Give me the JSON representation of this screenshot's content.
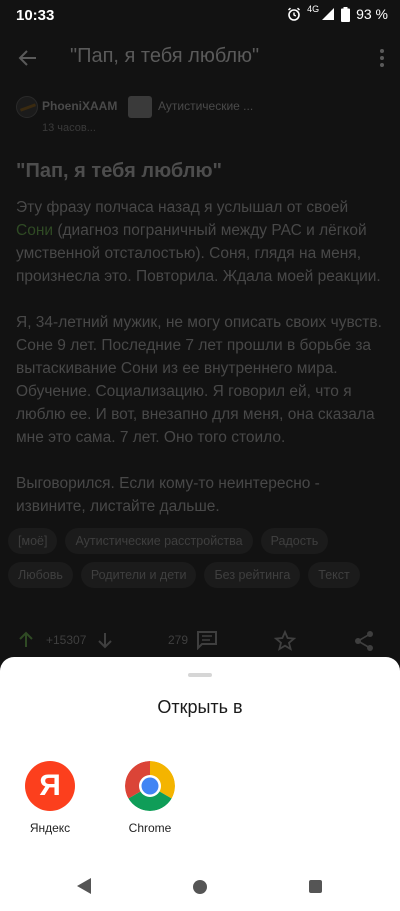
{
  "status": {
    "time": "10:33",
    "network": "4G",
    "battery": "93 %"
  },
  "app_bar": {
    "title": "\"Пап, я тебя люблю\""
  },
  "post": {
    "author": "PhoeniXAAM",
    "community": "Аутистические ...",
    "time": "13 часов...",
    "title": "\"Пап, я тебя люблю\"",
    "p1_before": "Эту фразу полчаса назад я услышал от своей ",
    "p1_link": "Сони",
    "p1_after": " (диагноз пограничный между РАС и лёгкой умственной отсталостью). Соня, глядя на меня, произнесла это. Повторила. Ждала моей реакции.",
    "p2": "Я, 34-летний мужик, не могу описать своих чувств. Соне 9 лет. Последние 7 лет прошли в борьбе за вытаскивание Сони из ее внутреннего мира. Обучение. Социализацию. Я говорил ей, что я люблю ее. И вот, внезапно для меня, она сказала мне это сама. 7 лет. Оно того стоило.",
    "p3": "Выговорился. Если кому-то неинтересно - извините, листайте дальше.",
    "tags": [
      "[моё]",
      "Аутистические расстройства",
      "Радость",
      "Любовь",
      "Родители и дети",
      "Без рейтинга",
      "Текст"
    ],
    "rating": "+15307",
    "comments": "279"
  },
  "sheet": {
    "title": "Открыть в",
    "apps": [
      {
        "label": "Яндекс",
        "icon": "yandex-icon"
      },
      {
        "label": "Chrome",
        "icon": "chrome-icon"
      }
    ]
  },
  "colors": {
    "yandex": "#fc3f1d",
    "chrome_red": "#db4437",
    "chrome_yellow": "#f4b400",
    "chrome_green": "#0f9d58",
    "chrome_blue": "#4285f4"
  }
}
